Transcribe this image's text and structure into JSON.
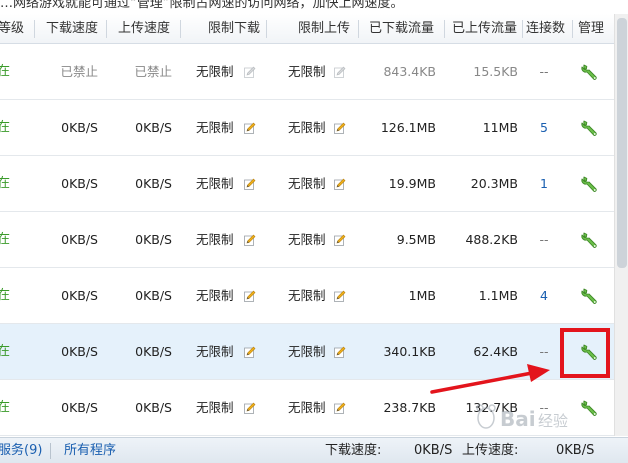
{
  "notice": "…网络游戏就能可通过“管理”限制占网速的访问网络，加快上网速度。",
  "headers": {
    "level": "等级",
    "download_speed": "下载速度",
    "upload_speed": "上传速度",
    "download_limit": "限制下载",
    "upload_limit": "限制上传",
    "downloaded": "已下载流量",
    "uploaded": "已上传流量",
    "connections": "连接数",
    "manage": "管理"
  },
  "rows": [
    {
      "status": "在",
      "dspeed": "已禁止",
      "uspeed": "已禁止",
      "dlimit": "无限制",
      "ulimit": "无限制",
      "dflow": "843.4KB",
      "uflow": "15.5KB",
      "conn": "--",
      "disabled": true
    },
    {
      "status": "在",
      "dspeed": "0KB/S",
      "uspeed": "0KB/S",
      "dlimit": "无限制",
      "ulimit": "无限制",
      "dflow": "126.1MB",
      "uflow": "11MB",
      "conn": "5"
    },
    {
      "status": "在",
      "dspeed": "0KB/S",
      "uspeed": "0KB/S",
      "dlimit": "无限制",
      "ulimit": "无限制",
      "dflow": "19.9MB",
      "uflow": "20.3MB",
      "conn": "1"
    },
    {
      "status": "在",
      "dspeed": "0KB/S",
      "uspeed": "0KB/S",
      "dlimit": "无限制",
      "ulimit": "无限制",
      "dflow": "9.5MB",
      "uflow": "488.2KB",
      "conn": "--"
    },
    {
      "status": "在",
      "dspeed": "0KB/S",
      "uspeed": "0KB/S",
      "dlimit": "无限制",
      "ulimit": "无限制",
      "dflow": "1MB",
      "uflow": "1.1MB",
      "conn": "4"
    },
    {
      "status": "在",
      "dspeed": "0KB/S",
      "uspeed": "0KB/S",
      "dlimit": "无限制",
      "ulimit": "无限制",
      "dflow": "340.1KB",
      "uflow": "62.4KB",
      "conn": "--",
      "selected": true
    },
    {
      "status": "在",
      "dspeed": "0KB/S",
      "uspeed": "0KB/S",
      "dlimit": "无限制",
      "ulimit": "无限制",
      "dflow": "238.7KB",
      "uflow": "132.7KB",
      "conn": "--"
    }
  ],
  "footer": {
    "services": "服务(9)",
    "all_programs": "所有程序",
    "download_speed_label": "下载速度:",
    "download_speed_value": "0KB/S",
    "upload_speed_label": "上传速度:",
    "upload_speed_value": "0KB/S"
  },
  "colors": {
    "status_green": "#3a9a2a",
    "link_blue": "#1a5fb0",
    "highlight_red": "#e3141c",
    "selected_row": "#e5f1fb"
  },
  "icons": {
    "edit": "pencil-edit-icon",
    "manage": "wrench-icon"
  }
}
